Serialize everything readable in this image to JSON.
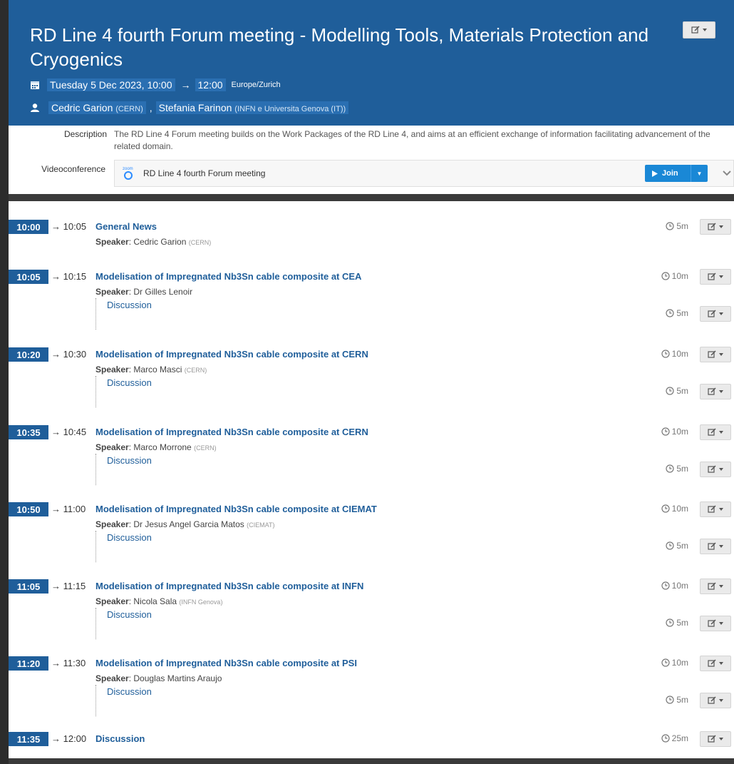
{
  "event": {
    "title": "RD Line 4 fourth Forum meeting -  Modelling Tools, Materials Protection and Cryogenics",
    "date_start": "Tuesday 5 Dec 2023, 10:00",
    "arrow": "→",
    "date_end": "12:00",
    "timezone": "Europe/Zurich",
    "chairs": [
      {
        "name": "Cedric Garion",
        "affiliation": "(CERN)"
      },
      {
        "name": "Stefania Farinon",
        "affiliation": "(INFN e Universita Genova (IT))"
      }
    ],
    "chair_separator": ","
  },
  "info": {
    "description_label": "Description",
    "description_text": "The RD Line 4 Forum meeting builds on the Work Packages of the RD Line 4, and aims at an efficient exchange of information facilitating advancement of the related domain.",
    "videoconference_label": "Videoconference",
    "vc_name": "RD Line 4 fourth Forum meeting",
    "zoom_label": "zoom",
    "join_label": "Join"
  },
  "speaker_label": "Speaker",
  "discussion_label": "Discussion",
  "entries": [
    {
      "start": "10:00",
      "end": "→ 10:05",
      "title": "General News",
      "speaker": "Cedric Garion",
      "aff": "(CERN)",
      "duration": "5m"
    },
    {
      "start": "10:05",
      "end": "→ 10:15",
      "title": "Modelisation of Impregnated Nb3Sn cable composite at CEA",
      "speaker": "Dr Gilles Lenoir",
      "aff": "",
      "duration": "10m",
      "disc_duration": "5m"
    },
    {
      "start": "10:20",
      "end": "→ 10:30",
      "title": "Modelisation of Impregnated Nb3Sn cable composite at CERN",
      "speaker": "Marco Masci",
      "aff": "(CERN)",
      "duration": "10m",
      "disc_duration": "5m"
    },
    {
      "start": "10:35",
      "end": "→ 10:45",
      "title": "Modelisation of Impregnated Nb3Sn cable composite at CERN",
      "speaker": "Marco Morrone",
      "aff": "(CERN)",
      "duration": "10m",
      "disc_duration": "5m"
    },
    {
      "start": "10:50",
      "end": "→ 11:00",
      "title": "Modelisation of Impregnated Nb3Sn cable composite at CIEMAT",
      "speaker": "Dr Jesus Angel Garcia Matos",
      "aff": "(CIEMAT)",
      "duration": "10m",
      "disc_duration": "5m"
    },
    {
      "start": "11:05",
      "end": "→ 11:15",
      "title": "Modelisation of Impregnated Nb3Sn cable composite at INFN",
      "speaker": "Nicola Sala",
      "aff": "(INFN Genova)",
      "duration": "10m",
      "disc_duration": "5m"
    },
    {
      "start": "11:20",
      "end": "→ 11:30",
      "title": "Modelisation of Impregnated Nb3Sn cable composite at PSI",
      "speaker": "Douglas Martins Araujo",
      "aff": "",
      "duration": "10m",
      "disc_duration": "5m"
    },
    {
      "start": "11:35",
      "end": "→ 12:00",
      "title": "Discussion",
      "duration": "25m"
    }
  ],
  "colors": {
    "header_bg": "#1f5e9a",
    "link": "#1f5e9a",
    "join_bg": "#1a88d6"
  }
}
